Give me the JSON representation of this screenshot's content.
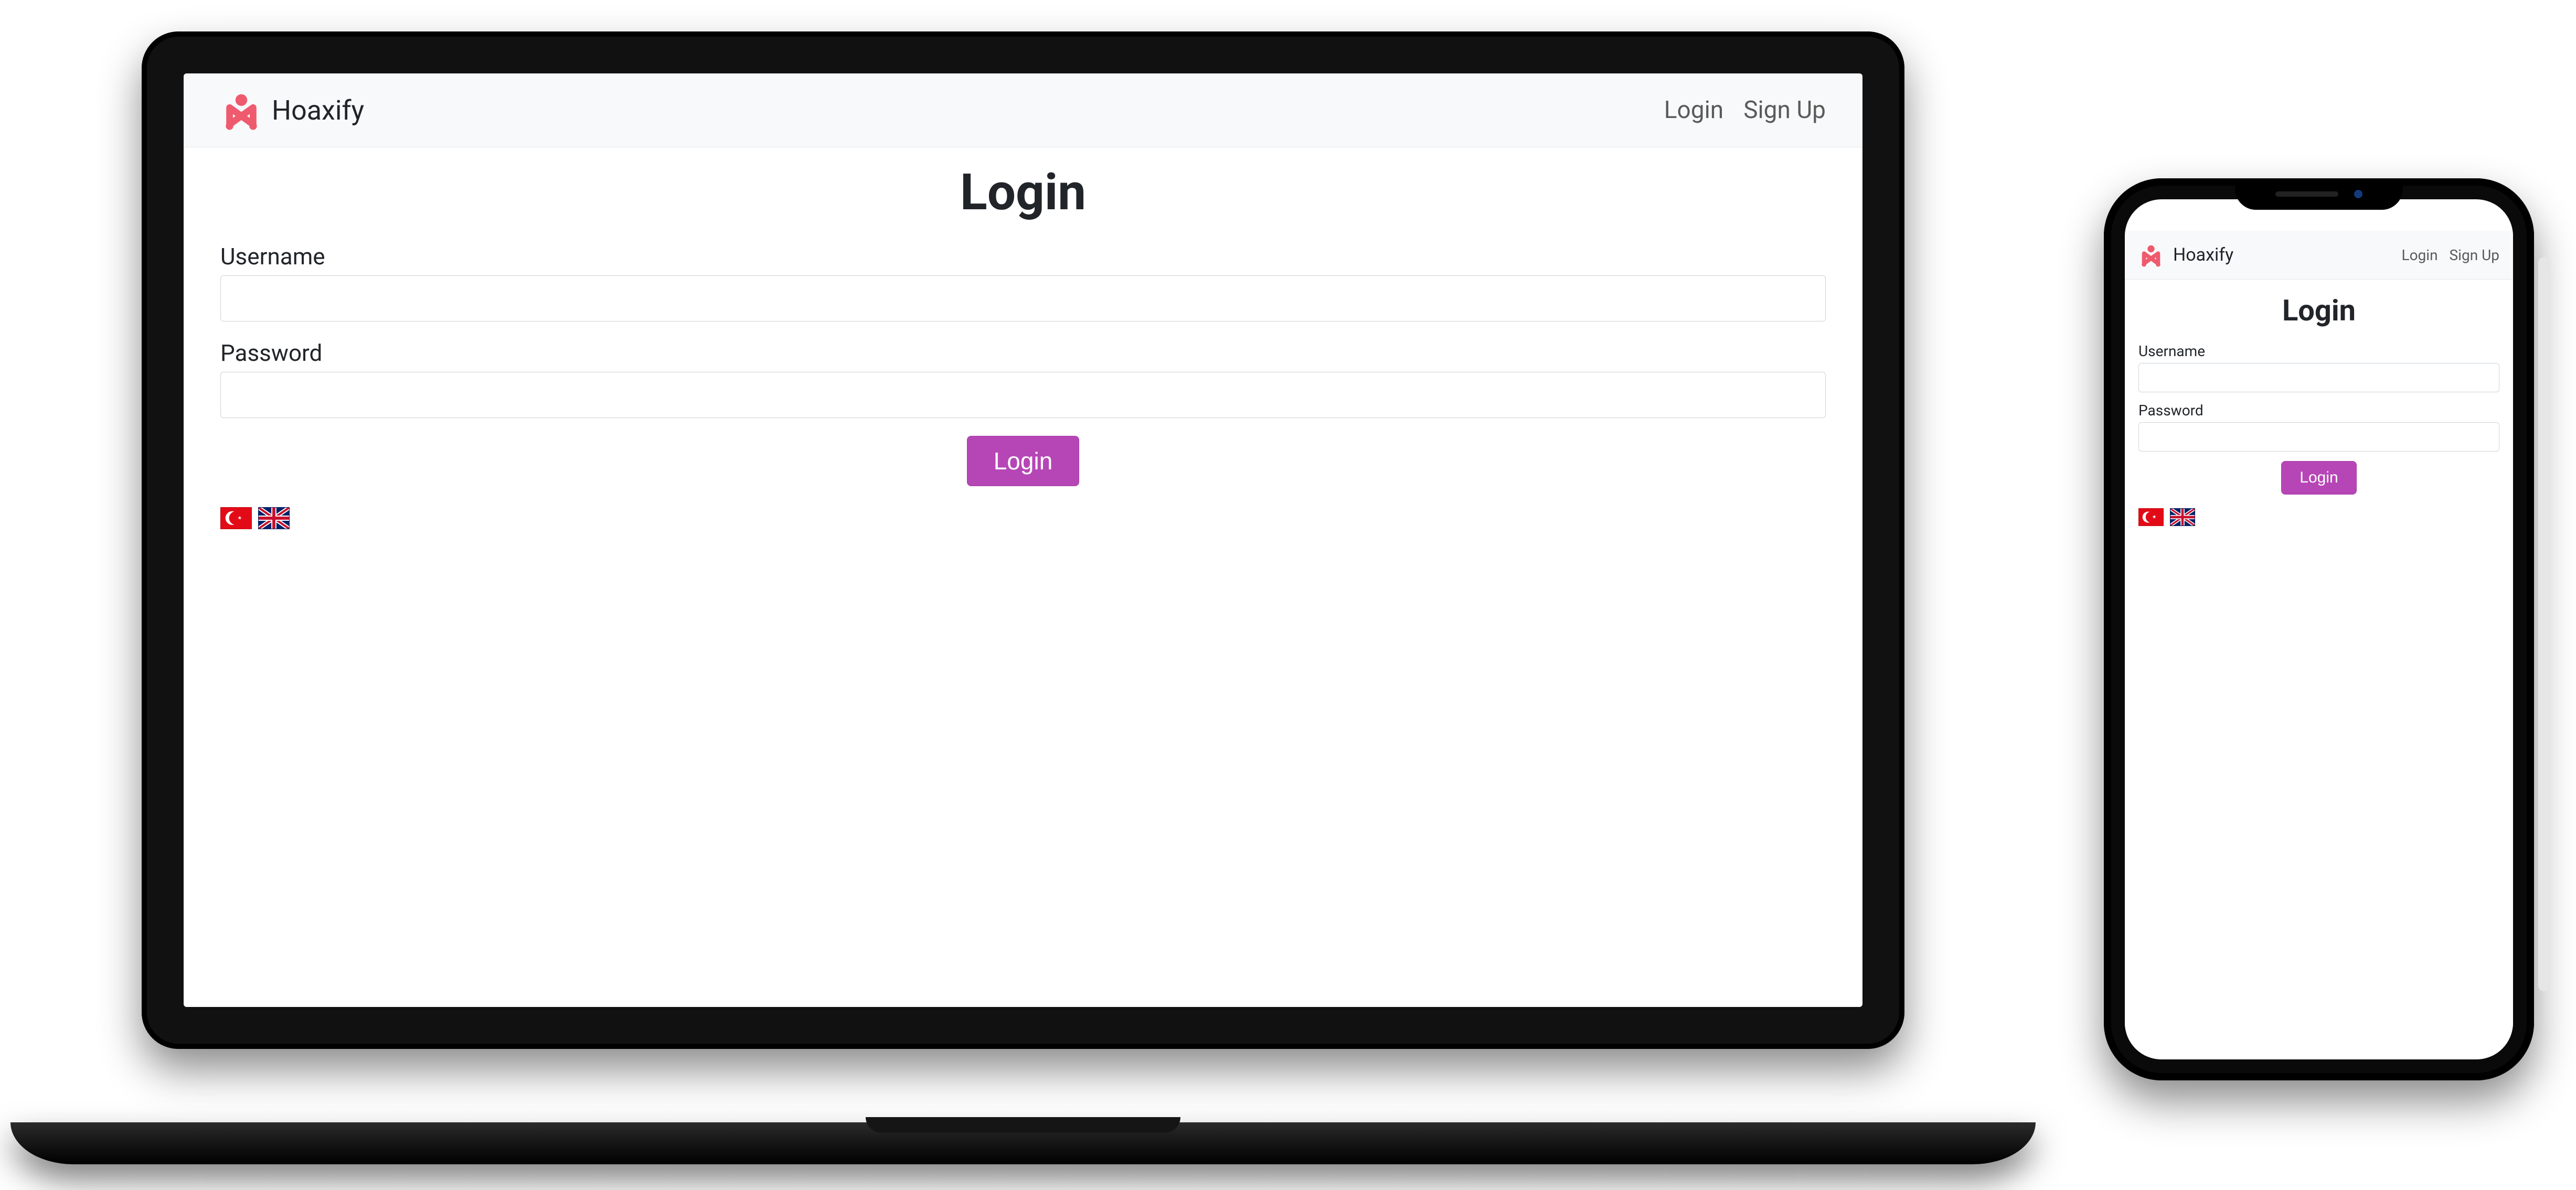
{
  "brand": {
    "name": "Hoaxify"
  },
  "nav": {
    "login": "Login",
    "signup": "Sign Up"
  },
  "login": {
    "title": "Login",
    "username_label": "Username",
    "password_label": "Password",
    "button": "Login"
  },
  "lang": {
    "options": [
      "tr",
      "en"
    ]
  }
}
